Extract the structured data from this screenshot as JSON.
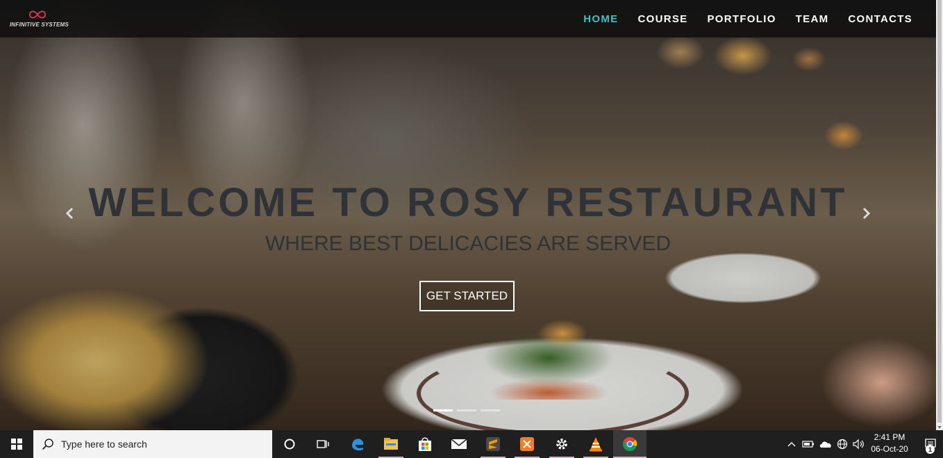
{
  "brand": {
    "name": "INFINITIVE SYSTEMS",
    "accent": "#d2384a"
  },
  "nav": {
    "items": [
      {
        "label": "HOME",
        "active": true
      },
      {
        "label": "COURSE"
      },
      {
        "label": "PORTFOLIO"
      },
      {
        "label": "TEAM"
      },
      {
        "label": "CONTACTS"
      }
    ],
    "active_color": "#3fc1c9"
  },
  "hero": {
    "title": "WELCOME TO ROSY RESTAURANT",
    "subtitle": "WHERE BEST DELICACIES ARE SERVED",
    "cta_label": "GET STARTED",
    "prev_icon": "chevron-left-icon",
    "next_icon": "chevron-right-icon",
    "slide_count": 3,
    "active_slide": 1
  },
  "taskbar": {
    "search_placeholder": "Type here to search",
    "pinned": [
      "task-view-icon",
      "cortana-icon",
      "edge-icon",
      "file-explorer-icon",
      "store-icon",
      "mail-icon",
      "sublime-text-icon",
      "xampp-icon",
      "settings-gear-icon",
      "vlc-icon",
      "chrome-icon"
    ],
    "tray_icons": [
      "chevron-up-icon",
      "battery-icon",
      "onedrive-icon",
      "network-globe-icon",
      "volume-icon"
    ],
    "time": "2:41 PM",
    "date": "06-Oct-20",
    "notification_count": "1"
  }
}
